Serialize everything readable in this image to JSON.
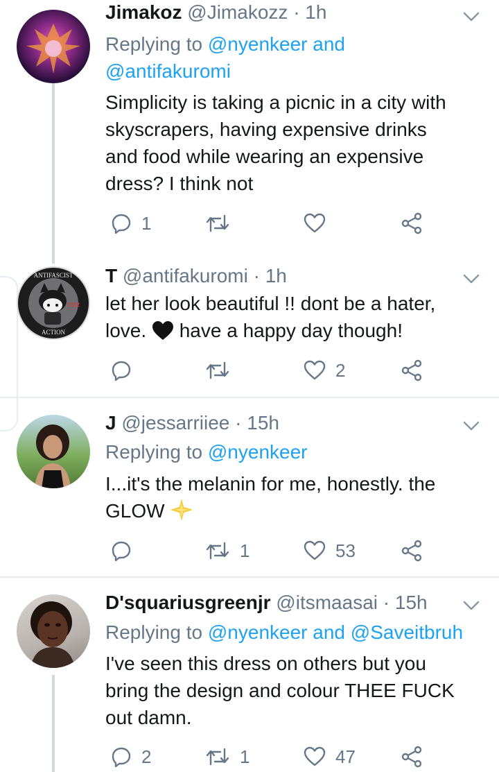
{
  "tweets": [
    {
      "name": "Jimakoz",
      "handle": "@Jimakozz",
      "time": "1h",
      "reply_prefix": "Replying to",
      "reply_user1": "@nyenkeer",
      "reply_and": "and",
      "reply_user2": "@antifakuromi",
      "lines": [
        "Simplicity is taking a picnic in a city with",
        "skyscrapers, having expensive drinks",
        "and food while wearing an expensive",
        "dress? I think not"
      ],
      "replies": "1",
      "retweets": "",
      "likes": ""
    },
    {
      "name": "T",
      "handle": "@antifakuromi",
      "time": "1h",
      "avatar_text_top": "ANTIFASCIST",
      "avatar_text_bottom": "ACTION",
      "avatar_badge": "1312",
      "line1": "let her look beautiful !! dont be a hater,",
      "line2_a": "love.",
      "line2_b": "have a happy day though!",
      "replies": "",
      "retweets": "",
      "likes": "2"
    },
    {
      "name": "J",
      "handle": "@jessarriiee",
      "time": "15h",
      "reply_prefix": "Replying to",
      "reply_user1": "@nyenkeer",
      "line1": "I...it's the melanin for me, honestly. the",
      "line2": "GLOW",
      "replies": "",
      "retweets": "1",
      "likes": "53"
    },
    {
      "name": "D'squariusgreenjr",
      "handle": "@itsmaasai",
      "time": "15h",
      "reply_prefix": "Replying to",
      "reply_user1": "@nyenkeer",
      "reply_and": "and",
      "reply_user2": "@Saveitbruh",
      "lines": [
        "I've seen this dress on others but you",
        "bring the design and colour THEE FUCK",
        "out damn."
      ],
      "replies": "2",
      "retweets": "1",
      "likes": "47"
    }
  ],
  "separator": "·",
  "icons": [
    "reply-icon",
    "retweet-icon",
    "like-icon",
    "share-icon",
    "chevron-down-icon",
    "black-heart-emoji",
    "sparkle-emoji"
  ],
  "colors": {
    "link": "#1da1f2",
    "muted": "#657786",
    "text": "#14171a",
    "divider": "#e6ecf0"
  }
}
